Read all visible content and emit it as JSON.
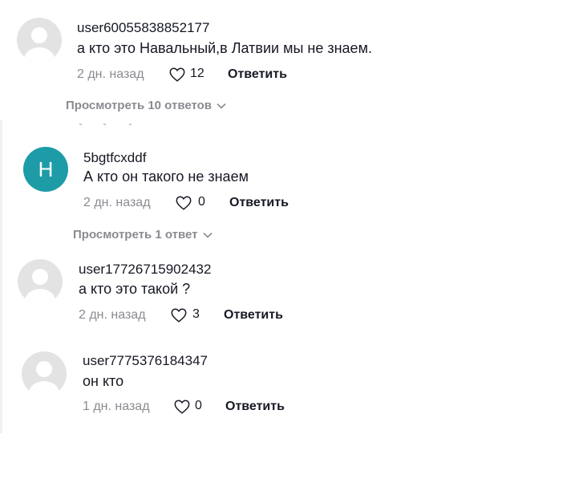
{
  "comments": [
    {
      "username": "user60055838852177",
      "text": "а кто это Навальный,в Латвии мы не знаем.",
      "time": "2 дн. назад",
      "likes": "12",
      "reply_label": "Ответить",
      "avatar_type": "default",
      "view_replies": "Просмотреть 10 ответов"
    },
    {
      "username": "5bgtfcxddf",
      "text": "А кто он такого не знаем",
      "time": "2 дн. назад",
      "likes": "0",
      "reply_label": "Ответить",
      "avatar_type": "letter",
      "avatar_letter": "H",
      "avatar_color": "#1d9ca7",
      "view_replies": "Просмотреть 1 ответ"
    },
    {
      "username": "user17726715902432",
      "text": "а кто это такой ?",
      "time": "2 дн. назад",
      "likes": "3",
      "reply_label": "Ответить",
      "avatar_type": "default"
    },
    {
      "username": "user7775376184347",
      "text": "он кто",
      "time": "1 дн. назад",
      "likes": "0",
      "reply_label": "Ответить",
      "avatar_type": "default"
    }
  ],
  "icons": {
    "like": "heart-outline-icon",
    "expand": "chevron-down-icon"
  }
}
